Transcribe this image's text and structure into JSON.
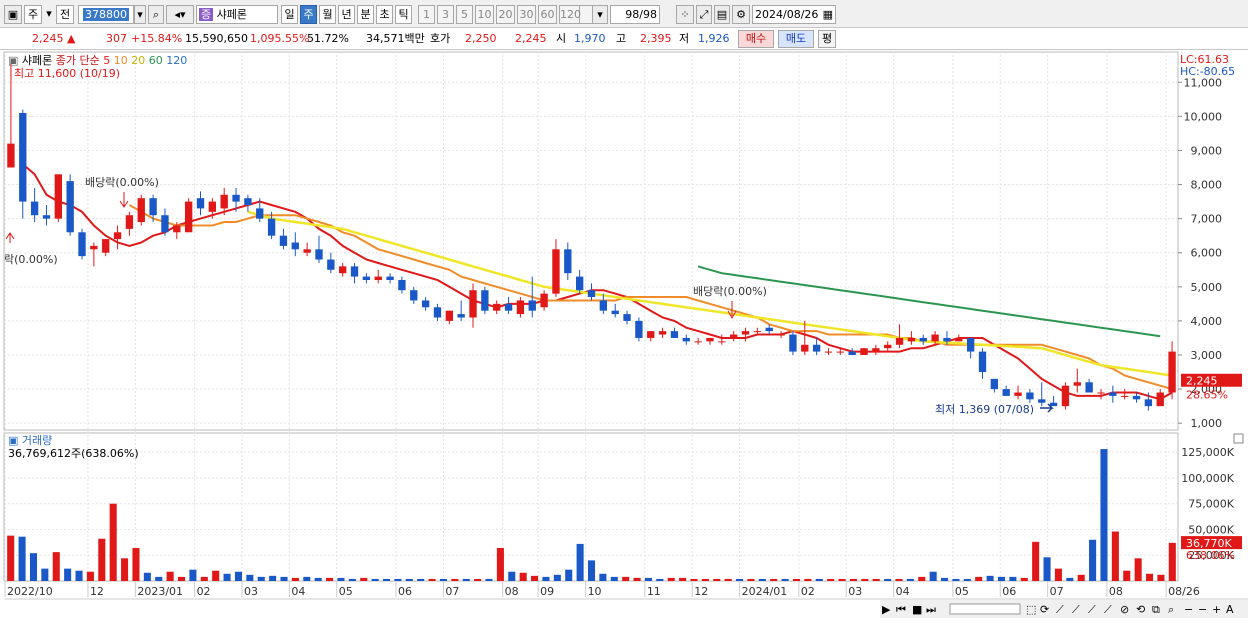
{
  "toolbar": {
    "market": "주",
    "prev_label": "전",
    "code": "378800",
    "stock_badge": "증",
    "stock_name": "샤페론",
    "periods": [
      "일",
      "주",
      "월",
      "년",
      "분",
      "초",
      "틱"
    ],
    "active_period": "주",
    "intervals": [
      "1",
      "3",
      "5",
      "10",
      "20",
      "30",
      "60",
      "120"
    ],
    "count": "98",
    "count_total": "/98",
    "date": "2024/08/26"
  },
  "info": {
    "price": "2,245",
    "arrow": "▲",
    "change": "307",
    "change_pct": "+15.84%",
    "volume": "15,590,650",
    "volume_pct": "1,095.55%",
    "turnover": "51.72%",
    "amount": "34,571백만",
    "hoga_label": "호가",
    "ask": "2,250",
    "bid": "2,245",
    "open_label": "시",
    "open": "1,970",
    "high_label": "고",
    "high": "2,395",
    "low_label": "저",
    "low": "1,926",
    "buy_label": "매수",
    "sell_label": "매도",
    "eval_label": "평"
  },
  "legend": {
    "name": "샤페론",
    "indicator": "종가 단순",
    "ma": [
      "5",
      "10",
      "20",
      "60",
      "120"
    ]
  },
  "annotations": {
    "high": "최고 11,600 (10/19)",
    "low": "최저 1,369 (07/08)",
    "dividend1": "배당락(0.00%)",
    "dividend2": "배당락(0.00%)",
    "dividend0": "락(0.00%)"
  },
  "right_labels": {
    "lc": "LC:61.63",
    "hc": "HC:-80.65",
    "price_tag": "2,245",
    "pct_tag": "28.65%",
    "vol_tag": "36,770K",
    "vol_pct_tag": "638.06%"
  },
  "volume_panel": {
    "title": "거래량",
    "value": "36,769,612주(638.06%)"
  },
  "colors": {
    "up": "#e01818",
    "down": "#1a58c8",
    "ma5": "#e01818",
    "ma10": "#f08c28",
    "ma20": "#f0e628",
    "ma60": "#2a9650",
    "accent": "#3a78c8"
  },
  "chart_data": [
    {
      "type": "candlestick",
      "title": "",
      "ylim": [
        800,
        11800
      ],
      "y_ticks": [
        1000,
        2000,
        3000,
        4000,
        5000,
        6000,
        7000,
        8000,
        9000,
        10000,
        11000
      ],
      "y_tick_labels": [
        "1,000",
        "2,000",
        "3,000",
        "4,000",
        "5,000",
        "6,000",
        "7,000",
        "8,000",
        "9,000",
        "10,000",
        "11,000"
      ],
      "x_labels": [
        "2022/10",
        "12",
        "2023/01",
        "02",
        "03",
        "04",
        "05",
        "06",
        "07",
        "08",
        "09",
        "10",
        "11",
        "12",
        "2024/01",
        "02",
        "03",
        "04",
        "05",
        "06",
        "07",
        "08",
        "08/26"
      ],
      "x_label_idx": [
        0,
        7,
        11,
        16,
        20,
        24,
        28,
        33,
        37,
        42,
        45,
        49,
        54,
        58,
        62,
        67,
        71,
        75,
        80,
        84,
        88,
        93,
        98
      ],
      "ohlc": [
        [
          8500,
          11600,
          8500,
          9200
        ],
        [
          10100,
          10200,
          7000,
          7500
        ],
        [
          7500,
          7900,
          6900,
          7100
        ],
        [
          7100,
          7400,
          6800,
          7000
        ],
        [
          7000,
          8300,
          6900,
          8300
        ],
        [
          8100,
          8300,
          6500,
          6600
        ],
        [
          6600,
          6700,
          5800,
          5900
        ],
        [
          6100,
          6300,
          5600,
          6200
        ],
        [
          6000,
          6400,
          5900,
          6400
        ],
        [
          6400,
          6800,
          6100,
          6600
        ],
        [
          6700,
          7200,
          6500,
          7100
        ],
        [
          6900,
          7700,
          6800,
          7600
        ],
        [
          7600,
          7700,
          6900,
          7100
        ],
        [
          7100,
          7300,
          6500,
          6600
        ],
        [
          6600,
          6900,
          6400,
          6800
        ],
        [
          6600,
          7600,
          6600,
          7500
        ],
        [
          7600,
          7800,
          7100,
          7300
        ],
        [
          7200,
          7600,
          7000,
          7500
        ],
        [
          7300,
          7900,
          7100,
          7700
        ],
        [
          7700,
          7900,
          7200,
          7500
        ],
        [
          7600,
          7700,
          7200,
          7400
        ],
        [
          7300,
          7600,
          6900,
          7000
        ],
        [
          7000,
          7200,
          6400,
          6500
        ],
        [
          6500,
          6700,
          6100,
          6200
        ],
        [
          6300,
          6600,
          5900,
          6100
        ],
        [
          6000,
          6300,
          5900,
          6100
        ],
        [
          6100,
          6500,
          5700,
          5800
        ],
        [
          5800,
          6000,
          5400,
          5500
        ],
        [
          5400,
          5700,
          5300,
          5600
        ],
        [
          5600,
          5700,
          5100,
          5300
        ],
        [
          5300,
          5400,
          5100,
          5200
        ],
        [
          5200,
          5500,
          5100,
          5300
        ],
        [
          5300,
          5400,
          5100,
          5200
        ],
        [
          5200,
          5300,
          4800,
          4900
        ],
        [
          4900,
          5000,
          4500,
          4600
        ],
        [
          4600,
          4700,
          4300,
          4400
        ],
        [
          4400,
          4500,
          4000,
          4100
        ],
        [
          4000,
          4300,
          3900,
          4300
        ],
        [
          4200,
          4600,
          4000,
          4100
        ],
        [
          4100,
          5100,
          3800,
          4900
        ],
        [
          4900,
          5000,
          4200,
          4300
        ],
        [
          4300,
          4600,
          4200,
          4500
        ],
        [
          4500,
          4700,
          4200,
          4300
        ],
        [
          4200,
          4700,
          4100,
          4600
        ],
        [
          4600,
          5300,
          4100,
          4300
        ],
        [
          4400,
          4900,
          4300,
          4800
        ],
        [
          4800,
          6400,
          4700,
          6100
        ],
        [
          6100,
          6300,
          5200,
          5400
        ],
        [
          5300,
          5500,
          4800,
          4900
        ],
        [
          4900,
          5100,
          4600,
          4700
        ],
        [
          4600,
          4800,
          4200,
          4300
        ],
        [
          4300,
          4500,
          4100,
          4200
        ],
        [
          4200,
          4300,
          3900,
          4000
        ],
        [
          4000,
          4100,
          3400,
          3500
        ],
        [
          3500,
          3700,
          3400,
          3700
        ],
        [
          3600,
          3800,
          3500,
          3700
        ],
        [
          3700,
          3800,
          3500,
          3500
        ],
        [
          3500,
          3600,
          3300,
          3400
        ],
        [
          3400,
          3500,
          3300,
          3400
        ],
        [
          3400,
          3500,
          3300,
          3500
        ],
        [
          3400,
          3600,
          3300,
          3400
        ],
        [
          3500,
          3700,
          3400,
          3600
        ],
        [
          3600,
          3800,
          3400,
          3700
        ],
        [
          3700,
          3800,
          3600,
          3700
        ],
        [
          3800,
          3900,
          3600,
          3700
        ],
        [
          3600,
          3700,
          3500,
          3600
        ],
        [
          3600,
          3700,
          3000,
          3100
        ],
        [
          3100,
          4000,
          3000,
          3300
        ],
        [
          3300,
          3500,
          3000,
          3100
        ],
        [
          3100,
          3200,
          3000,
          3100
        ],
        [
          3100,
          3200,
          3000,
          3100
        ],
        [
          3100,
          3200,
          3000,
          3000
        ],
        [
          3000,
          3200,
          3000,
          3200
        ],
        [
          3100,
          3300,
          3000,
          3200
        ],
        [
          3200,
          3400,
          3100,
          3300
        ],
        [
          3300,
          3900,
          3200,
          3500
        ],
        [
          3400,
          3700,
          3300,
          3500
        ],
        [
          3500,
          3600,
          3300,
          3400
        ],
        [
          3400,
          3700,
          3300,
          3600
        ],
        [
          3500,
          3700,
          3300,
          3400
        ],
        [
          3400,
          3600,
          3400,
          3500
        ],
        [
          3500,
          3500,
          2900,
          3100
        ],
        [
          3100,
          3200,
          2300,
          2500
        ],
        [
          2300,
          2300,
          1900,
          2000
        ],
        [
          2000,
          2100,
          1800,
          1800
        ],
        [
          1800,
          2100,
          1700,
          1900
        ],
        [
          1900,
          2000,
          1600,
          1700
        ],
        [
          1700,
          2200,
          1500,
          1600
        ],
        [
          1600,
          1800,
          1500,
          1500
        ],
        [
          1500,
          2200,
          1400,
          2100
        ],
        [
          2100,
          2600,
          1900,
          2200
        ],
        [
          2200,
          2300,
          1900,
          1900
        ],
        [
          1900,
          2000,
          1700,
          1900
        ],
        [
          1900,
          2100,
          1600,
          1800
        ],
        [
          1800,
          2000,
          1700,
          1800
        ],
        [
          1800,
          1900,
          1600,
          1700
        ],
        [
          1700,
          1900,
          1369,
          1500
        ],
        [
          1500,
          2000,
          1500,
          1900
        ],
        [
          1900,
          3400,
          1700,
          3100
        ]
      ],
      "ma_series": [
        {
          "name": "5",
          "color": "#e01818",
          "start": 1,
          "values": [
            8600,
            8300,
            7700,
            7500,
            7400,
            7200,
            6800,
            6500,
            6300,
            6200,
            6300,
            6500,
            6600,
            6800,
            6900,
            7000,
            7100,
            7200,
            7300,
            7400,
            7500,
            7400,
            7300,
            7200,
            7000,
            6700,
            6500,
            6200,
            6000,
            5800,
            5700,
            5600,
            5500,
            5400,
            5300,
            5200,
            5000,
            4800,
            4600,
            4500,
            4400,
            4500,
            4500,
            4500,
            4600,
            4600,
            4700,
            4800,
            4900,
            4900,
            4800,
            4700,
            4500,
            4300,
            4100,
            4000,
            3800,
            3700,
            3600,
            3500,
            3500,
            3500,
            3600,
            3600,
            3600,
            3700,
            3600,
            3500,
            3300,
            3200,
            3100,
            3100,
            3100,
            3100,
            3100,
            3200,
            3200,
            3300,
            3400,
            3500,
            3500,
            3500,
            3300,
            3100,
            2900,
            2600,
            2300,
            2100,
            1900,
            1800,
            1800,
            1800,
            1900,
            1900,
            1900,
            1800,
            1700,
            1900
          ]
        },
        {
          "name": "10",
          "color": "#f08c28",
          "start": 10,
          "values": [
            7400,
            7200,
            7000,
            6900,
            6800,
            6800,
            6800,
            6800,
            6900,
            6900,
            7000,
            7100,
            7100,
            7100,
            7100,
            7000,
            6900,
            6800,
            6600,
            6500,
            6300,
            6100,
            6000,
            5900,
            5800,
            5700,
            5600,
            5500,
            5300,
            5200,
            5100,
            5000,
            4900,
            4800,
            4700,
            4600,
            4600,
            4600,
            4600,
            4600,
            4600,
            4600,
            4700,
            4700,
            4700,
            4700,
            4700,
            4700,
            4600,
            4500,
            4400,
            4300,
            4200,
            4100,
            3900,
            3800,
            3700,
            3700,
            3700,
            3600,
            3600,
            3600,
            3600,
            3600,
            3600,
            3500,
            3500,
            3400,
            3400,
            3300,
            3300,
            3300,
            3300,
            3300,
            3300,
            3300,
            3300,
            3300,
            3200,
            3100,
            3000,
            2900,
            2700,
            2600,
            2400,
            2300,
            2200,
            2100,
            2000
          ]
        },
        {
          "name": "20",
          "color": "#f0e628",
          "start": 20,
          "values": [
            7200,
            7100,
            7000,
            6950,
            6900,
            6850,
            6800,
            6750,
            6700,
            6600,
            6500,
            6400,
            6300,
            6200,
            6100,
            6000,
            5900,
            5800,
            5700,
            5600,
            5500,
            5400,
            5300,
            5200,
            5100,
            5000,
            4950,
            4900,
            4850,
            4800,
            4750,
            4700,
            4650,
            4600,
            4550,
            4500,
            4450,
            4400,
            4350,
            4300,
            4250,
            4200,
            4150,
            4100,
            4050,
            4000,
            3950,
            3900,
            3850,
            3800,
            3750,
            3700,
            3650,
            3600,
            3550,
            3500,
            3450,
            3400,
            3380,
            3360,
            3340,
            3320,
            3300,
            3280,
            3260,
            3240,
            3220,
            3200,
            3100,
            3000,
            2900,
            2800,
            2700,
            2650,
            2600,
            2550,
            2500,
            2450,
            2400
          ]
        },
        {
          "name": "60",
          "color": "#2a9650",
          "start": 58,
          "values": [
            5600,
            5500,
            5400,
            5350,
            5300,
            5250,
            5200,
            5150,
            5100,
            5050,
            5000,
            4950,
            4900,
            4850,
            4800,
            4750,
            4700,
            4650,
            4600,
            4550,
            4500,
            4450,
            4400,
            4350,
            4300,
            4250,
            4200,
            4150,
            4100,
            4050,
            4000,
            3950,
            3900,
            3850,
            3800,
            3750,
            3700,
            3650,
            3600,
            3550
          ]
        }
      ]
    },
    {
      "type": "bar",
      "title": "거래량",
      "ylim": [
        0,
        130000
      ],
      "y_ticks": [
        25000,
        50000,
        75000,
        100000,
        125000
      ],
      "y_tick_labels": [
        "25,000K",
        "50,000K",
        "75,000K",
        "100,000K",
        "125,000K"
      ],
      "values": [
        44000,
        43000,
        27000,
        12000,
        28000,
        12000,
        10000,
        9000,
        41000,
        75000,
        22000,
        32000,
        8000,
        4000,
        9000,
        4000,
        11000,
        4000,
        10000,
        7000,
        9000,
        6000,
        4000,
        5000,
        4000,
        3000,
        4000,
        3000,
        3000,
        3000,
        2000,
        3000,
        2000,
        2000,
        2000,
        2000,
        2000,
        2000,
        2000,
        2000,
        2000,
        2000,
        2000,
        32000,
        9000,
        8000,
        5000,
        4000,
        6000,
        11000,
        36000,
        20000,
        7000,
        4000,
        4000,
        3000,
        3000,
        2000,
        3000,
        3000,
        2000,
        2000,
        2000,
        2000,
        2000,
        2000,
        2000,
        2000,
        2000,
        2000,
        2000,
        2000,
        2000,
        2000,
        2000,
        2000,
        2000,
        2000,
        2000,
        2000,
        4000,
        9000,
        3000,
        2000,
        2000,
        4000,
        5000,
        4000,
        4000,
        3000,
        38000,
        23000,
        12000,
        3000,
        6000,
        40000,
        128000,
        48000,
        10000,
        22000,
        7000,
        6000,
        37000
      ]
    }
  ]
}
